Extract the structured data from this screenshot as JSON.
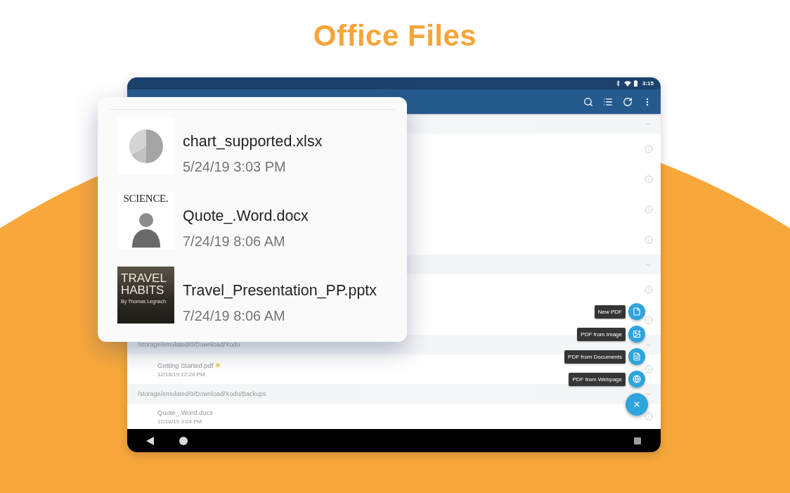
{
  "title": "Office Files",
  "status_bar": {
    "time": "3:15"
  },
  "recent_files": [
    {
      "kind": "chart",
      "name": "chart_supported.xlsx",
      "date": "5/24/19 3:03 PM"
    },
    {
      "kind": "document",
      "name": "Quote_.Word.docx",
      "date": "7/24/19 8:06 AM",
      "thumbnail_heading": "SCIENCE."
    },
    {
      "kind": "slide",
      "name": "Travel_Presentation_PP.pptx",
      "date": "7/24/19 8:06 AM",
      "thumbnail_title": "TRAVEL HABITS",
      "thumbnail_byline": "By Thomas Legnach"
    }
  ],
  "file_list": {
    "sections": [
      {
        "rows": [
          {
            "kind": "covered"
          },
          {
            "kind": "covered"
          },
          {
            "kind": "covered"
          },
          {
            "kind": "covered"
          }
        ]
      },
      {
        "rows": [
          {
            "kind": "covered"
          },
          {
            "kind": "covered"
          }
        ]
      },
      {
        "path": "/storage/emulated/0/Download/Xodo",
        "rows": [
          {
            "kind": "file",
            "name": "Getting Started.pdf",
            "date": "12/16/19 12:24 PM",
            "starred": true
          }
        ]
      },
      {
        "path": "/storage/emulated/0/Download/Xodo/Backups",
        "rows": [
          {
            "kind": "file",
            "name": "Quote_.Word.docx",
            "date": "12/18/19 3:04 PM",
            "starred": false
          }
        ]
      }
    ]
  },
  "fab": {
    "expanded": true,
    "actions": [
      {
        "kind": "new",
        "label": "New PDF"
      },
      {
        "kind": "image",
        "label": "PDF from Image"
      },
      {
        "kind": "documents",
        "label": "PDF from Documents"
      },
      {
        "kind": "webpage",
        "label": "PDF from Webpage"
      }
    ]
  }
}
